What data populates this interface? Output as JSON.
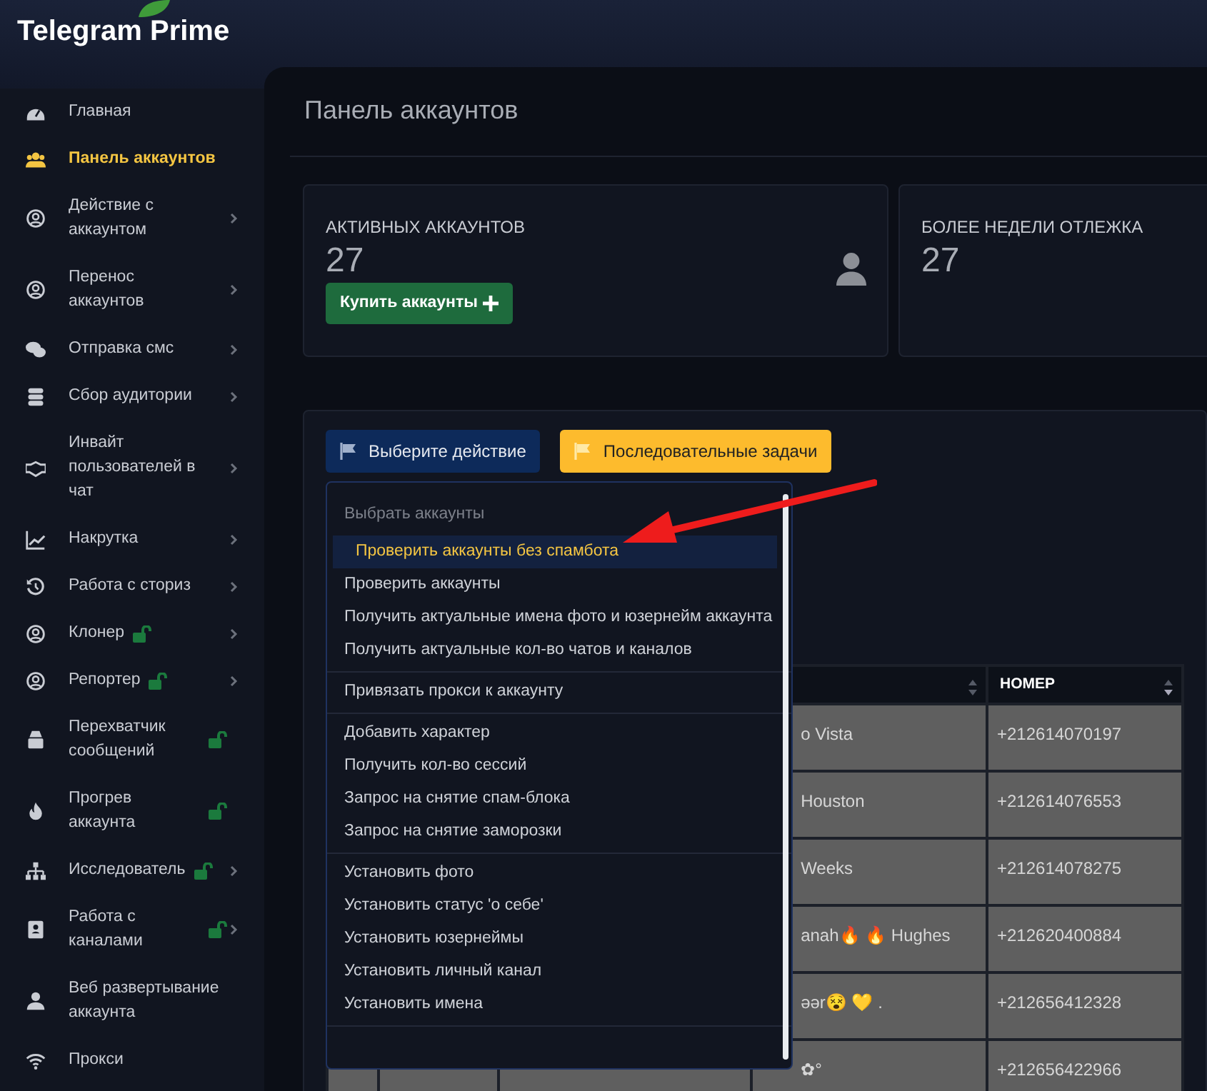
{
  "app": {
    "title": "Telegram Prime"
  },
  "sidebar": {
    "items": [
      {
        "label": "Главная",
        "selected": false,
        "locked": false,
        "submenu": false
      },
      {
        "label": "Панель аккаунтов",
        "selected": true,
        "locked": false,
        "submenu": false
      },
      {
        "label": "Действие с аккаунтом",
        "selected": false,
        "locked": false,
        "submenu": true
      },
      {
        "label": "Перенос аккаунтов",
        "selected": false,
        "locked": false,
        "submenu": true
      },
      {
        "label": "Отправка смс",
        "selected": false,
        "locked": false,
        "submenu": true
      },
      {
        "label": "Сбор аудитории",
        "selected": false,
        "locked": false,
        "submenu": true
      },
      {
        "label": "Инвайт пользователей в чат",
        "selected": false,
        "locked": false,
        "submenu": true
      },
      {
        "label": "Накрутка",
        "selected": false,
        "locked": false,
        "submenu": true
      },
      {
        "label": "Работа с сториз",
        "selected": false,
        "locked": false,
        "submenu": true
      },
      {
        "label": "Клонер",
        "selected": false,
        "locked": true,
        "submenu": true
      },
      {
        "label": "Репортер",
        "selected": false,
        "locked": true,
        "submenu": true
      },
      {
        "label": "Перехватчик сообщений",
        "selected": false,
        "locked": true,
        "submenu": false
      },
      {
        "label": "Прогрев аккаунта",
        "selected": false,
        "locked": true,
        "submenu": false
      },
      {
        "label": "Исследователь",
        "selected": false,
        "locked": true,
        "submenu": true
      },
      {
        "label": "Работа с каналами",
        "selected": false,
        "locked": true,
        "submenu": true
      },
      {
        "label": "Веб развертывание аккаунта",
        "selected": false,
        "locked": false,
        "submenu": false
      },
      {
        "label": "Прокси",
        "selected": false,
        "locked": false,
        "submenu": false
      }
    ]
  },
  "page": {
    "title": "Панель аккаунтов"
  },
  "stats": [
    {
      "label": "АКТИВНЫХ АККАУНТОВ",
      "value": "27",
      "button": "Купить аккаунты"
    },
    {
      "label": "БОЛЕЕ НЕДЕЛИ ОТЛЕЖКА",
      "value": "27"
    }
  ],
  "actions": [
    {
      "label": "Выберите действие",
      "kind": "primary"
    },
    {
      "label": "Последовательные задачи",
      "kind": "warning"
    }
  ],
  "dropdown": {
    "groups": [
      [
        {
          "label": "Выбрать аккаунты",
          "kind": "header",
          "selected": false
        },
        {
          "label": "Проверить аккаунты без спамбота",
          "kind": "item",
          "selected": true
        },
        {
          "label": "Проверить аккаунты",
          "kind": "item",
          "selected": false
        },
        {
          "label": "Получить актуальные имена фото и юзернейм аккаунта",
          "kind": "item",
          "selected": false
        },
        {
          "label": "Получить актуальные кол-во чатов и каналов",
          "kind": "item",
          "selected": false
        }
      ],
      [
        {
          "label": "Привязать прокси к аккаунту",
          "kind": "item",
          "selected": false
        }
      ],
      [
        {
          "label": "Добавить характер",
          "kind": "item",
          "selected": false
        },
        {
          "label": "Получить кол-во сессий",
          "kind": "item",
          "selected": false
        },
        {
          "label": "Запрос на снятие спам-блока",
          "kind": "item",
          "selected": false
        },
        {
          "label": "Запрос на снятие заморозки",
          "kind": "item",
          "selected": false
        }
      ],
      [
        {
          "label": "Установить фото",
          "kind": "item",
          "selected": false
        },
        {
          "label": "Установить статус 'о себе'",
          "kind": "item",
          "selected": false
        },
        {
          "label": "Установить юзернеймы",
          "kind": "item",
          "selected": false
        },
        {
          "label": "Установить личный канал",
          "kind": "item",
          "selected": false
        },
        {
          "label": "Установить имена",
          "kind": "item",
          "selected": false
        }
      ]
    ]
  },
  "table": {
    "columns": [
      {
        "label": "НОМЕР"
      }
    ],
    "rows": [
      {
        "name": "o Vista",
        "phone": "+212614070197"
      },
      {
        "name": "Houston",
        "phone": "+212614076553"
      },
      {
        "name": "Weeks",
        "phone": "+212614078275"
      },
      {
        "name": "anah🔥 🔥 Hughes",
        "phone": "+212620400884"
      },
      {
        "name": "əər😵 💛 .",
        "phone": "+212656412328"
      },
      {
        "name": "✿°",
        "phone": "+212656422966"
      }
    ]
  }
}
